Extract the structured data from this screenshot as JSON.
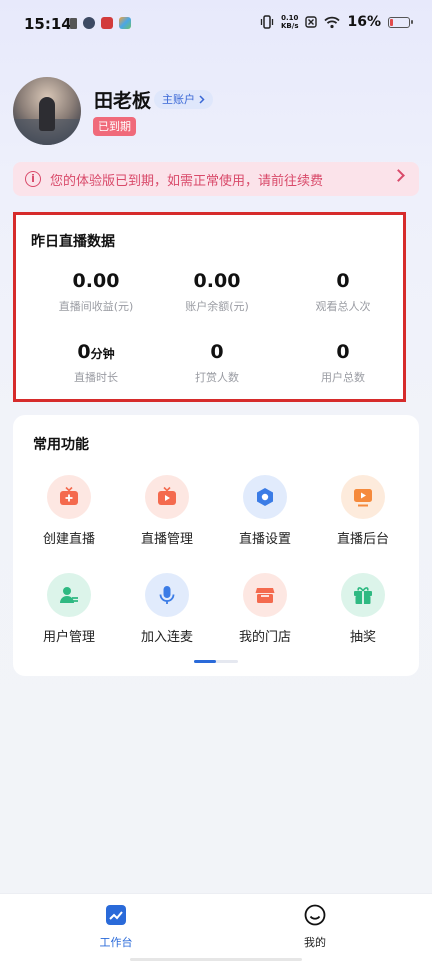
{
  "status_bar": {
    "time": "15:14",
    "net_speed_value": "0.10",
    "net_speed_unit": "KB/s",
    "battery_percent": "16%",
    "battery_level": 0.16,
    "battery_color": "#e24b4b"
  },
  "profile": {
    "name": "田老板",
    "account_tag": "主账户",
    "expired_badge": "已到期"
  },
  "notice": {
    "icon": "info-icon",
    "text": "您的体验版已到期，如需正常使用，请前往续费",
    "color": "#d94a6a"
  },
  "stats": {
    "title": "昨日直播数据",
    "items": [
      {
        "value": "0.00",
        "unit": "",
        "label": "直播间收益(元)"
      },
      {
        "value": "0.00",
        "unit": "",
        "label": "账户余额(元)"
      },
      {
        "value": "0",
        "unit": "",
        "label": "观看总人次"
      },
      {
        "value": "0",
        "unit": "分钟",
        "label": "直播时长"
      },
      {
        "value": "0",
        "unit": "",
        "label": "打赏人数"
      },
      {
        "value": "0",
        "unit": "",
        "label": "用户总数"
      }
    ]
  },
  "functions": {
    "title": "常用功能",
    "items": [
      {
        "label": "创建直播",
        "icon": "create-live-icon"
      },
      {
        "label": "直播管理",
        "icon": "live-manage-icon"
      },
      {
        "label": "直播设置",
        "icon": "live-settings-icon"
      },
      {
        "label": "直播后台",
        "icon": "live-backend-icon"
      },
      {
        "label": "用户管理",
        "icon": "user-manage-icon"
      },
      {
        "label": "加入连麦",
        "icon": "microphone-icon"
      },
      {
        "label": "我的门店",
        "icon": "store-icon"
      },
      {
        "label": "抽奖",
        "icon": "gift-icon"
      }
    ],
    "pager_active": 1,
    "pager_total": 2
  },
  "bottom_nav": {
    "items": [
      {
        "label": "工作台",
        "icon": "workbench-icon",
        "active": true
      },
      {
        "label": "我的",
        "icon": "smiley-icon",
        "active": false
      }
    ],
    "active_color": "#2a6ad9"
  }
}
